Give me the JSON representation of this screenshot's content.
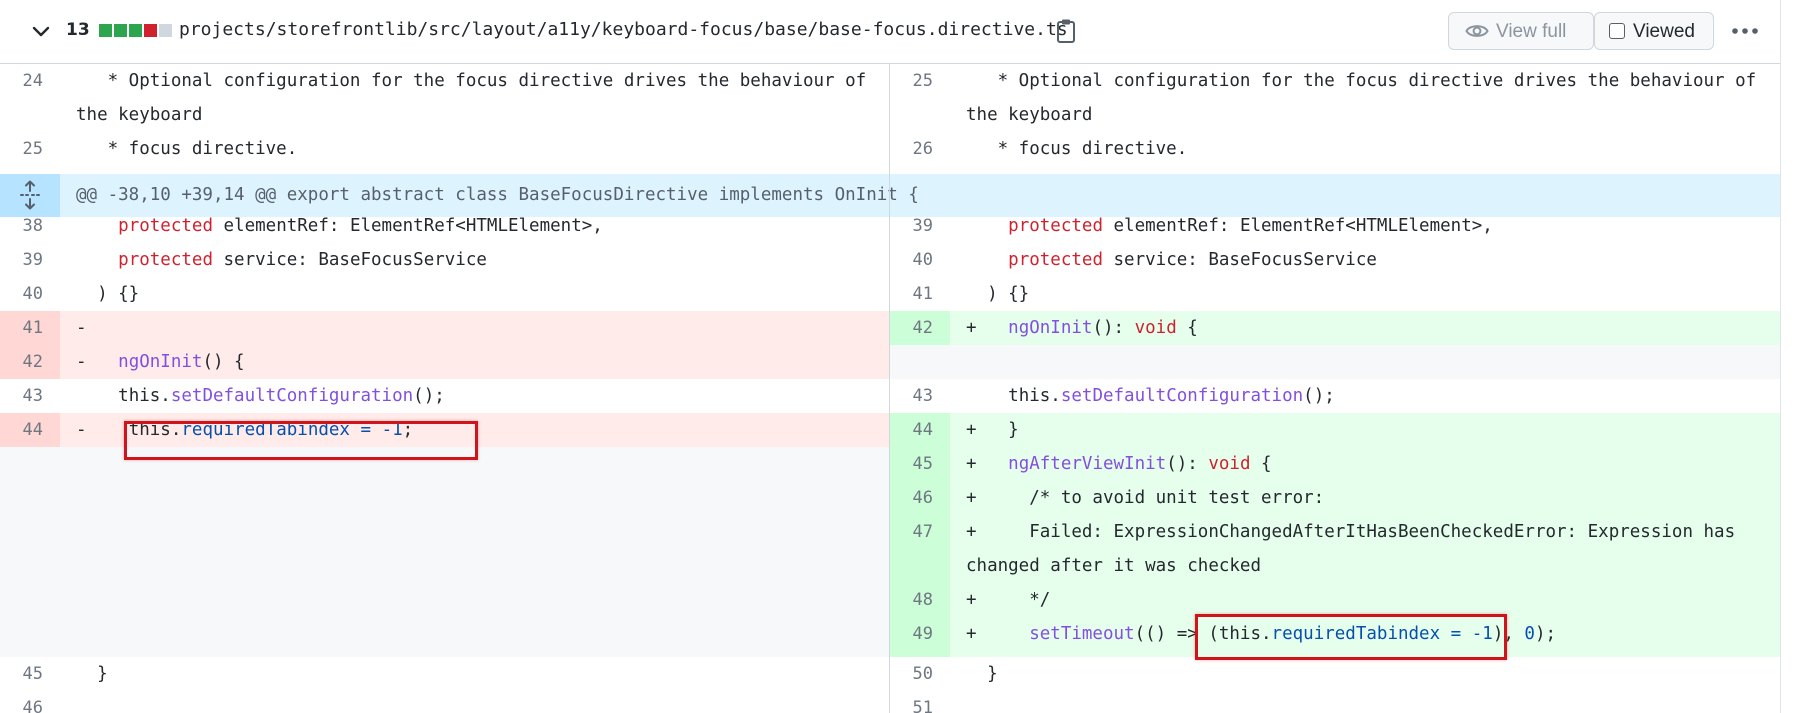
{
  "file": {
    "changes_count": "13",
    "path": "projects/storefrontlib/src/layout/a11y/keyboard-focus/base/base-focus.directive.ts",
    "view_full_label": "View full",
    "viewed_label": "Viewed",
    "diffstat_colors": [
      "#2da44e",
      "#2da44e",
      "#2da44e",
      "#cf222e",
      "#d0d7de"
    ]
  },
  "hunk_header": "@@ -38,10 +39,14 @@ export abstract class BaseFocusDirective implements OnInit {",
  "left": {
    "line_24": "24",
    "line_24_text": "   * Optional configuration for the focus directive drives the behaviour of the keyboard",
    "line_25": "25",
    "line_25_text": "   * focus directive.",
    "line_38": "38",
    "line_38_kw": "protected",
    "line_38_rest": " elementRef: ElementRef<HTMLElement>,",
    "line_39": "39",
    "line_39_kw": "protected",
    "line_39_rest": " service: BaseFocusService",
    "line_40": "40",
    "line_40_text": "  ) {}",
    "line_41": "41",
    "line_41_text": "-",
    "line_42": "42",
    "line_42_prefix": "-   ",
    "line_42_fn": "ngOnInit",
    "line_42_rest": "() {",
    "line_43": "43",
    "line_43_pre": "this.",
    "line_43_fn": "setDefaultConfiguration",
    "line_43_rest": "();",
    "line_44": "44",
    "line_44_prefix": "-",
    "line_44_pre": "this.",
    "line_44_prop": "requiredTabindex",
    "line_44_op": " = ",
    "line_44_num": "-1",
    "line_44_end": ";",
    "line_45": "45",
    "line_45_text": "  }",
    "line_46": "46"
  },
  "right": {
    "line_25": "25",
    "line_25_text": "   * Optional configuration for the focus directive drives the behaviour of the keyboard",
    "line_26": "26",
    "line_26_text": "   * focus directive.",
    "line_39": "39",
    "line_39_kw": "protected",
    "line_39_rest": " elementRef: ElementRef<HTMLElement>,",
    "line_40": "40",
    "line_40_kw": "protected",
    "line_40_rest": " service: BaseFocusService",
    "line_41": "41",
    "line_41_text": "  ) {}",
    "line_42": "42",
    "line_42_prefix": "+   ",
    "line_42_fn": "ngOnInit",
    "line_42_mid": "(): ",
    "line_42_kw": "void",
    "line_42_end": " {",
    "line_43": "43",
    "line_43_pre": "this.",
    "line_43_fn": "setDefaultConfiguration",
    "line_43_rest": "();",
    "line_44": "44",
    "line_44_text": "+   }",
    "line_45": "45",
    "line_45_prefix": "+   ",
    "line_45_fn": "ngAfterViewInit",
    "line_45_mid": "(): ",
    "line_45_kw": "void",
    "line_45_end": " {",
    "line_46": "46",
    "line_46_text": "+     /* to avoid unit test error:",
    "line_47": "47",
    "line_47_text": "+     Failed: ExpressionChangedAfterItHasBeenCheckedError: Expression has changed after it was checked",
    "line_48": "48",
    "line_48_text": "+     */",
    "line_49": "49",
    "line_49_prefix": "+     ",
    "line_49_fn": "setTimeout",
    "line_49_a": "(() => (this.",
    "line_49_prop": "requiredTabindex",
    "line_49_op": " = ",
    "line_49_num1": "-1",
    "line_49_b": "), ",
    "line_49_num2": "0",
    "line_49_c": ");",
    "line_50": "50",
    "line_50_text": "  }",
    "line_51": "51"
  }
}
